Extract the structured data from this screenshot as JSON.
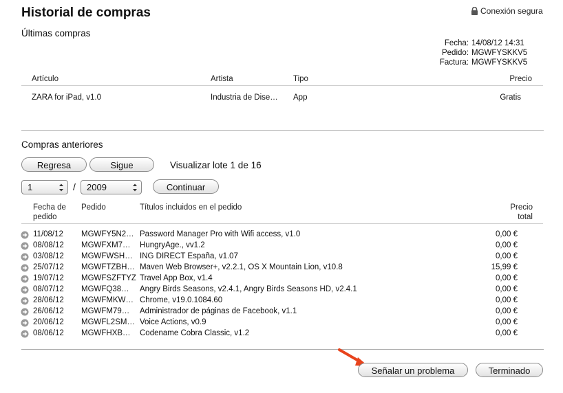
{
  "window": {
    "title": "Historial de compras",
    "secure_label": "Conexión segura"
  },
  "recent": {
    "heading": "Últimas compras",
    "meta": [
      {
        "label": "Fecha:",
        "value": "14/08/12 14:31"
      },
      {
        "label": "Pedido:",
        "value": "MGWFYSKKV5"
      },
      {
        "label": "Factura:",
        "value": "MGWFYSKKV5"
      }
    ],
    "columns": {
      "item": "Artículo",
      "artist": "Artista",
      "type": "Tipo",
      "price": "Precio"
    },
    "rows": [
      {
        "item": "ZARA for iPad, v1.0",
        "artist": "Industria de Diseño…",
        "type": "App",
        "price": "Gratis"
      }
    ]
  },
  "previous": {
    "heading": "Compras anteriores",
    "back_label": "Regresa",
    "next_label": "Sigue",
    "batch_label": "Visualizar lote 1 de 16",
    "month_value": "1",
    "separator": "/",
    "year_value": "2009",
    "continue_label": "Continuar",
    "columns": {
      "date": "Fecha de pedido",
      "order": "Pedido",
      "titles": "Títulos incluidos en el pedido",
      "total": "Precio total"
    },
    "orders": [
      {
        "date": "11/08/12",
        "order": "MGWFY5N2…",
        "titles": "Password Manager Pro with Wifi access, v1.0",
        "total": "0,00 €"
      },
      {
        "date": "08/08/12",
        "order": "MGWFXM7…",
        "titles": "HungryAge., vv1.2",
        "total": "0,00 €"
      },
      {
        "date": "03/08/12",
        "order": "MGWFWSH…",
        "titles": "ING DIRECT España, v1.07",
        "total": "0,00 €"
      },
      {
        "date": "25/07/12",
        "order": "MGWFTZBH…",
        "titles": "Maven Web Browser+, v2.2.1, OS X Mountain Lion, v10.8",
        "total": "15,99 €"
      },
      {
        "date": "19/07/12",
        "order": "MGWFSZFTYZ",
        "titles": "Travel App Box, v1.4",
        "total": "0,00 €"
      },
      {
        "date": "08/07/12",
        "order": "MGWFQ38…",
        "titles": "Angry Birds Seasons, v2.4.1, Angry Birds Seasons HD, v2.4.1",
        "total": "0,00 €"
      },
      {
        "date": "28/06/12",
        "order": "MGWFMKW…",
        "titles": "Chrome, v19.0.1084.60",
        "total": "0,00 €"
      },
      {
        "date": "26/06/12",
        "order": "MGWFM79…",
        "titles": "Administrador de páginas de Facebook, v1.1",
        "total": "0,00 €"
      },
      {
        "date": "20/06/12",
        "order": "MGWFL2SM…",
        "titles": "Voice Actions, v0.9",
        "total": "0,00 €"
      },
      {
        "date": "08/06/12",
        "order": "MGWFHXB…",
        "titles": "Codename Cobra Classic, v1.2",
        "total": "0,00 €"
      }
    ]
  },
  "footer": {
    "report_label": "Señalar un problema",
    "done_label": "Terminado"
  },
  "colors": {
    "annotation_arrow": "#e8431c"
  }
}
